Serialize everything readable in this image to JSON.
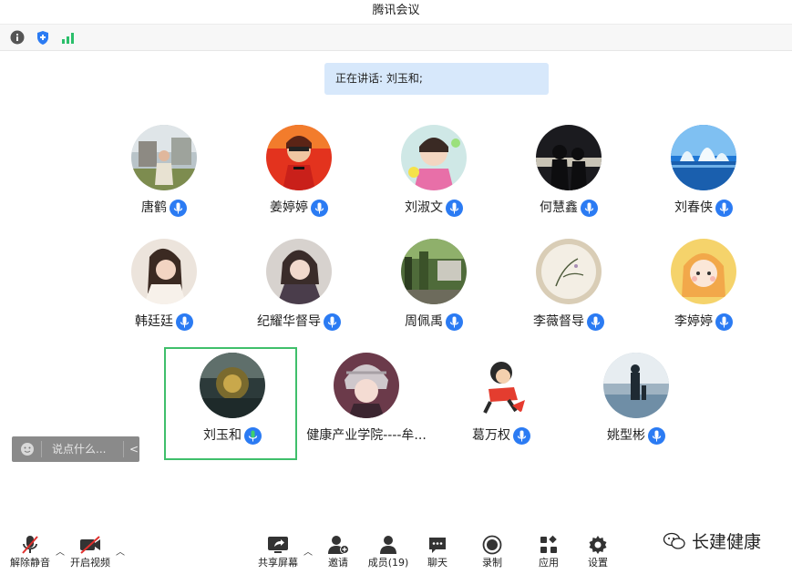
{
  "window": {
    "title": "腾讯会议"
  },
  "speaking_banner": {
    "text": "正在讲话: 刘玉和;"
  },
  "participants": [
    {
      "name": "唐鹤",
      "mic": "on"
    },
    {
      "name": "姜婷婷",
      "mic": "on"
    },
    {
      "name": "刘淑文",
      "mic": "on"
    },
    {
      "name": "何慧鑫",
      "mic": "on"
    },
    {
      "name": "刘春侠",
      "mic": "on"
    },
    {
      "name": "韩廷廷",
      "mic": "on"
    },
    {
      "name": "纪耀华督导",
      "mic": "on"
    },
    {
      "name": "周佩禹",
      "mic": "on"
    },
    {
      "name": "李薇督导",
      "mic": "on"
    },
    {
      "name": "李婷婷",
      "mic": "on"
    },
    {
      "name": "刘玉和",
      "mic": "speaking"
    },
    {
      "name": "健康产业学院----牟...",
      "mic": "none"
    },
    {
      "name": "葛万权",
      "mic": "on"
    },
    {
      "name": "姚型彬",
      "mic": "on"
    }
  ],
  "chat": {
    "placeholder": "说点什么...",
    "collapse": "<"
  },
  "toolbar": {
    "unmute": "解除静音",
    "start_video": "开启视频",
    "share_screen": "共享屏幕",
    "invite": "邀请",
    "members": "成员(19)",
    "chat": "聊天",
    "record": "录制",
    "apps": "应用",
    "settings": "设置"
  },
  "watermark": {
    "text": "长建健康"
  },
  "colors": {
    "accent": "#2b7bf3",
    "speaking_border": "#3fbf6b",
    "banner_bg": "#d7e8fb"
  }
}
